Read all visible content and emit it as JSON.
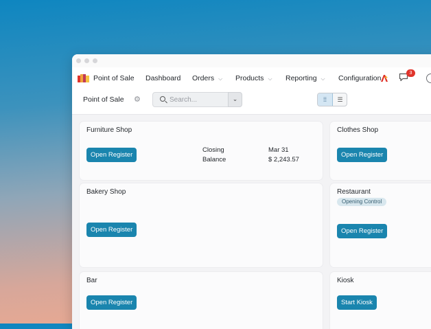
{
  "navbar": {
    "app_name": "Point of Sale",
    "menu": [
      {
        "label": "Dashboard"
      },
      {
        "label": "Orders"
      },
      {
        "label": "Products"
      },
      {
        "label": "Reporting"
      },
      {
        "label": "Configuration"
      }
    ],
    "messages_count": "3"
  },
  "control": {
    "title": "Point of Sale",
    "search_placeholder": "Search..."
  },
  "cards": [
    {
      "title": "Furniture Shop",
      "button": "Open Register",
      "closing_label_1": "Closing",
      "closing_label_2": "Balance",
      "closing_date": "Mar 31",
      "closing_balance": "$ 2,243.57"
    },
    {
      "title": "Clothes Shop",
      "button": "Open Register"
    },
    {
      "title": "Bakery Shop",
      "button": "Open Register"
    },
    {
      "title": "Restaurant",
      "badge": "Opening Control",
      "button": "Open Register"
    },
    {
      "title": "Bar",
      "button": "Open Register"
    },
    {
      "title": "Kiosk",
      "button": "Start Kiosk"
    }
  ],
  "colors": {
    "primary": "#1a85ae",
    "badge": "#e0342b"
  }
}
